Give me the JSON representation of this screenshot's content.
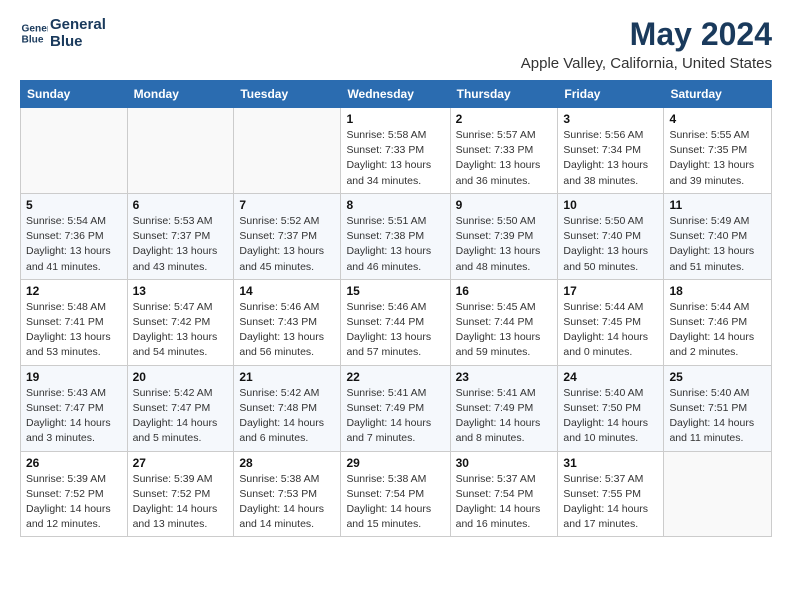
{
  "logo": {
    "line1": "General",
    "line2": "Blue"
  },
  "title": "May 2024",
  "location": "Apple Valley, California, United States",
  "days_header": [
    "Sunday",
    "Monday",
    "Tuesday",
    "Wednesday",
    "Thursday",
    "Friday",
    "Saturday"
  ],
  "weeks": [
    [
      {
        "day": "",
        "info": ""
      },
      {
        "day": "",
        "info": ""
      },
      {
        "day": "",
        "info": ""
      },
      {
        "day": "1",
        "info": "Sunrise: 5:58 AM\nSunset: 7:33 PM\nDaylight: 13 hours\nand 34 minutes."
      },
      {
        "day": "2",
        "info": "Sunrise: 5:57 AM\nSunset: 7:33 PM\nDaylight: 13 hours\nand 36 minutes."
      },
      {
        "day": "3",
        "info": "Sunrise: 5:56 AM\nSunset: 7:34 PM\nDaylight: 13 hours\nand 38 minutes."
      },
      {
        "day": "4",
        "info": "Sunrise: 5:55 AM\nSunset: 7:35 PM\nDaylight: 13 hours\nand 39 minutes."
      }
    ],
    [
      {
        "day": "5",
        "info": "Sunrise: 5:54 AM\nSunset: 7:36 PM\nDaylight: 13 hours\nand 41 minutes."
      },
      {
        "day": "6",
        "info": "Sunrise: 5:53 AM\nSunset: 7:37 PM\nDaylight: 13 hours\nand 43 minutes."
      },
      {
        "day": "7",
        "info": "Sunrise: 5:52 AM\nSunset: 7:37 PM\nDaylight: 13 hours\nand 45 minutes."
      },
      {
        "day": "8",
        "info": "Sunrise: 5:51 AM\nSunset: 7:38 PM\nDaylight: 13 hours\nand 46 minutes."
      },
      {
        "day": "9",
        "info": "Sunrise: 5:50 AM\nSunset: 7:39 PM\nDaylight: 13 hours\nand 48 minutes."
      },
      {
        "day": "10",
        "info": "Sunrise: 5:50 AM\nSunset: 7:40 PM\nDaylight: 13 hours\nand 50 minutes."
      },
      {
        "day": "11",
        "info": "Sunrise: 5:49 AM\nSunset: 7:40 PM\nDaylight: 13 hours\nand 51 minutes."
      }
    ],
    [
      {
        "day": "12",
        "info": "Sunrise: 5:48 AM\nSunset: 7:41 PM\nDaylight: 13 hours\nand 53 minutes."
      },
      {
        "day": "13",
        "info": "Sunrise: 5:47 AM\nSunset: 7:42 PM\nDaylight: 13 hours\nand 54 minutes."
      },
      {
        "day": "14",
        "info": "Sunrise: 5:46 AM\nSunset: 7:43 PM\nDaylight: 13 hours\nand 56 minutes."
      },
      {
        "day": "15",
        "info": "Sunrise: 5:46 AM\nSunset: 7:44 PM\nDaylight: 13 hours\nand 57 minutes."
      },
      {
        "day": "16",
        "info": "Sunrise: 5:45 AM\nSunset: 7:44 PM\nDaylight: 13 hours\nand 59 minutes."
      },
      {
        "day": "17",
        "info": "Sunrise: 5:44 AM\nSunset: 7:45 PM\nDaylight: 14 hours\nand 0 minutes."
      },
      {
        "day": "18",
        "info": "Sunrise: 5:44 AM\nSunset: 7:46 PM\nDaylight: 14 hours\nand 2 minutes."
      }
    ],
    [
      {
        "day": "19",
        "info": "Sunrise: 5:43 AM\nSunset: 7:47 PM\nDaylight: 14 hours\nand 3 minutes."
      },
      {
        "day": "20",
        "info": "Sunrise: 5:42 AM\nSunset: 7:47 PM\nDaylight: 14 hours\nand 5 minutes."
      },
      {
        "day": "21",
        "info": "Sunrise: 5:42 AM\nSunset: 7:48 PM\nDaylight: 14 hours\nand 6 minutes."
      },
      {
        "day": "22",
        "info": "Sunrise: 5:41 AM\nSunset: 7:49 PM\nDaylight: 14 hours\nand 7 minutes."
      },
      {
        "day": "23",
        "info": "Sunrise: 5:41 AM\nSunset: 7:49 PM\nDaylight: 14 hours\nand 8 minutes."
      },
      {
        "day": "24",
        "info": "Sunrise: 5:40 AM\nSunset: 7:50 PM\nDaylight: 14 hours\nand 10 minutes."
      },
      {
        "day": "25",
        "info": "Sunrise: 5:40 AM\nSunset: 7:51 PM\nDaylight: 14 hours\nand 11 minutes."
      }
    ],
    [
      {
        "day": "26",
        "info": "Sunrise: 5:39 AM\nSunset: 7:52 PM\nDaylight: 14 hours\nand 12 minutes."
      },
      {
        "day": "27",
        "info": "Sunrise: 5:39 AM\nSunset: 7:52 PM\nDaylight: 14 hours\nand 13 minutes."
      },
      {
        "day": "28",
        "info": "Sunrise: 5:38 AM\nSunset: 7:53 PM\nDaylight: 14 hours\nand 14 minutes."
      },
      {
        "day": "29",
        "info": "Sunrise: 5:38 AM\nSunset: 7:54 PM\nDaylight: 14 hours\nand 15 minutes."
      },
      {
        "day": "30",
        "info": "Sunrise: 5:37 AM\nSunset: 7:54 PM\nDaylight: 14 hours\nand 16 minutes."
      },
      {
        "day": "31",
        "info": "Sunrise: 5:37 AM\nSunset: 7:55 PM\nDaylight: 14 hours\nand 17 minutes."
      },
      {
        "day": "",
        "info": ""
      }
    ]
  ]
}
